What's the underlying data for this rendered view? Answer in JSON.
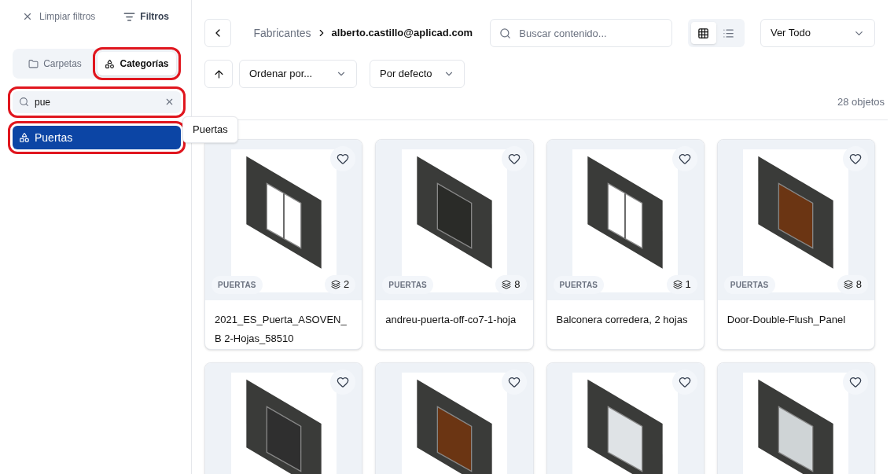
{
  "sidebar": {
    "clear_filters": "Limpiar filtros",
    "filters": "Filtros",
    "tabs": [
      {
        "label": "Carpetas",
        "selected": false,
        "highlighted": false
      },
      {
        "label": "Categorías",
        "selected": true,
        "highlighted": true
      }
    ],
    "search": {
      "value": "pue",
      "highlighted": true
    },
    "items": [
      {
        "label": "Puertas",
        "selected": true,
        "highlighted": true
      }
    ],
    "tooltip": "Puertas"
  },
  "toolbar": {
    "breadcrumb": [
      "Fabricantes",
      "alberto.castillo@aplicad.com"
    ],
    "search": {
      "placeholder": "Buscar contenido..."
    },
    "views": [
      {
        "kind": "grid",
        "selected": true
      },
      {
        "kind": "list",
        "selected": false
      }
    ],
    "filter": "Ver Todo",
    "sort": "Ordenar por...",
    "order": "Por defecto"
  },
  "count": "28 objetos",
  "cards": [
    {
      "category": "PUERTAS",
      "versions": "2",
      "name": "2021_ES_Puerta_ASOVEN_B 2-Hojas_58510",
      "favorite": false,
      "kind": "sliding"
    },
    {
      "category": "PUERTAS",
      "versions": "8",
      "name": "andreu-puerta-off-co7-1-hoja",
      "favorite": false,
      "kind": "single"
    },
    {
      "category": "PUERTAS",
      "versions": "1",
      "name": "Balconera corredera, 2 hojas",
      "favorite": false,
      "kind": "sliding"
    },
    {
      "category": "PUERTAS",
      "versions": "8",
      "name": "Door-Double-Flush_Panel",
      "favorite": false,
      "kind": "wood"
    },
    {
      "favorite": false,
      "kind": "dark"
    },
    {
      "favorite": false,
      "kind": "wood"
    },
    {
      "favorite": false,
      "kind": "glass"
    },
    {
      "favorite": false,
      "kind": "round"
    }
  ]
}
